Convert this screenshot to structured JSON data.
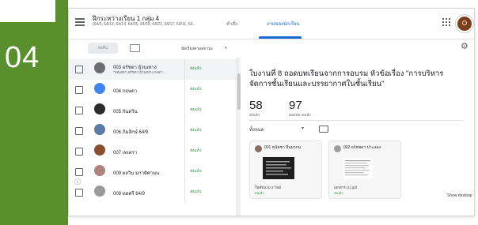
{
  "slide": {
    "number": "04",
    "accent": "#5a8f2e"
  },
  "header": {
    "class_title": "ฝึกระหว่างเรียน 1 กลุ่ม 4",
    "class_subtitle": "(64/3, 64/13, 64/14, 64/25, 64/19, 64/21, 64/17, 64/11, 64...",
    "tabs": [
      {
        "label": "คำสั่ง",
        "active": false
      },
      {
        "label": "งานของนักเรียน",
        "active": true
      }
    ],
    "avatar_letter": "O",
    "apps_icon": "grid-icon",
    "menu_icon": "hamburger-icon"
  },
  "toolbar": {
    "return_label": "ส่งคืน",
    "sort_label": "จัดเรียงตามสถานะ",
    "mail_icon": "mail-icon",
    "settings_icon": "gear-icon"
  },
  "students": [
    {
      "name": "003 อรัชดา ยุ้วนเทาง",
      "attachment": "\"บทเสดา อรัชดา ยุ้วนเทาง 0497...",
      "status": "ส่งแล้ว",
      "selected": true,
      "avatar_color": "#6d6d6d"
    },
    {
      "name": "004 กฤษดา",
      "attachment": "",
      "status": "ส่งแล้ว",
      "selected": false,
      "avatar_color": "#4285f4"
    },
    {
      "name": "005 กันตวิน",
      "attachment": "",
      "status": "ส่งแล้ว",
      "selected": false,
      "avatar_color": "#2b2b2b"
    },
    {
      "name": "006 ภิมลิกษ์ 64/9",
      "attachment": "",
      "status": "ส่งแล้ว",
      "selected": false,
      "avatar_color": "#5b7aa6"
    },
    {
      "name": "007 เทเตรา",
      "attachment": "",
      "status": "ส่งแล้ว",
      "selected": false,
      "avatar_color": "#8a4e2f"
    },
    {
      "name": "009 ผลวิน มกาติศานน",
      "attachment": "",
      "status": "ส่งแล้ว",
      "selected": false,
      "avatar_color": "#b08383"
    },
    {
      "name": "009 ทดศรี 64/9",
      "attachment": "",
      "status": "ส่งแล้ว",
      "selected": false,
      "avatar_color": "#9a9a9a"
    }
  ],
  "detail": {
    "title": "ใบงานที่ 8 ถอดบทเรียนจากการอบรม หัวข้อเรื่อง \"การบริหารจัดการชั้นเรียนและบรรยากาศในชั้นเรียน\"",
    "submitted_count": "58",
    "submitted_label": "ส่งแล้ว",
    "assigned_count": "97",
    "assigned_label": "มอบหมายแล้ว",
    "filter_label": "ทั้งหมด",
    "folder_icon": "folder-icon",
    "cards": [
      {
        "name": "001 ธนัชชา ปิ่นมรกน",
        "file": "ใฟล์ชนาม 2 ไฟล์",
        "status": "ส่งแล้ว",
        "avatar_color": "#8d6e63"
      },
      {
        "name": "002 อรัชชดา ปาะแลง",
        "file": "เอกสาร (1).pdf",
        "status": "ส่งแล้ว",
        "avatar_color": "#9e9e9e"
      }
    ]
  },
  "show_desktop": "Show desktop",
  "help_icon": "help-icon"
}
